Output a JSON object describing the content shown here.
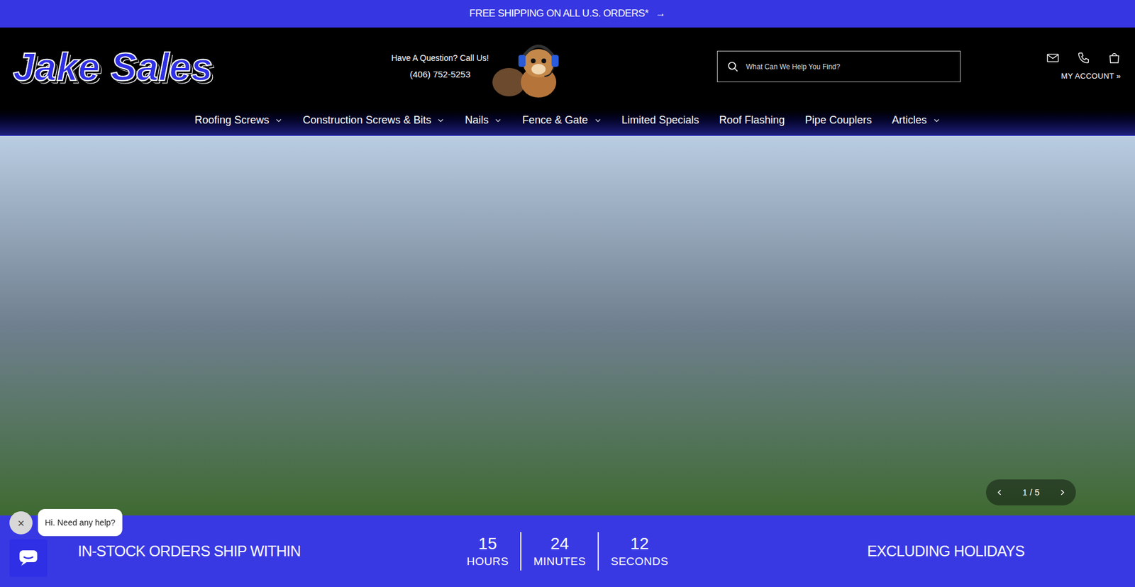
{
  "announcement": {
    "text": "FREE SHIPPING ON ALL U.S. ORDERS*",
    "icon": "→"
  },
  "header": {
    "logo": "Jake Sales",
    "contact_prompt": "Have A Question? Call Us!",
    "phone": "(406) 752-5253",
    "account": "MY ACCOUNT »"
  },
  "search": {
    "placeholder": "What Can We Help You Find?"
  },
  "nav": [
    {
      "label": "Roofing Screws",
      "dropdown": true
    },
    {
      "label": "Construction Screws & Bits",
      "dropdown": true
    },
    {
      "label": "Nails",
      "dropdown": true
    },
    {
      "label": "Fence & Gate",
      "dropdown": true
    },
    {
      "label": "Limited Specials",
      "dropdown": false
    },
    {
      "label": "Roof Flashing",
      "dropdown": false
    },
    {
      "label": "Pipe Couplers",
      "dropdown": false
    },
    {
      "label": "Articles",
      "dropdown": true
    }
  ],
  "slider": {
    "counter": "1 / 5"
  },
  "countdown": {
    "lead": "IN-STOCK ORDERS SHIP WITHIN",
    "units": [
      {
        "value": "15",
        "label": "HOURS"
      },
      {
        "value": "24",
        "label": "MINUTES"
      },
      {
        "value": "12",
        "label": "SECONDS"
      }
    ],
    "note": "EXCLUDING HOLIDAYS"
  },
  "chat": {
    "greeting": "Hi. Need any help?",
    "close": "×"
  }
}
